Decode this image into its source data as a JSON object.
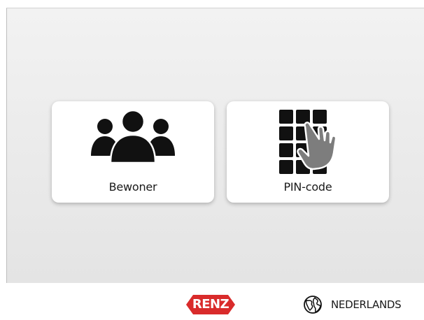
{
  "tiles": [
    {
      "label": "Bewoner",
      "icon": "people-group-icon"
    },
    {
      "label": "PIN-code",
      "icon": "keypad-hand-icon"
    }
  ],
  "footer": {
    "logo_text": "RENZ",
    "logo_color": "#d92b2b",
    "language_label": "NEDERLANDS",
    "language_icon": "globe-icon"
  }
}
